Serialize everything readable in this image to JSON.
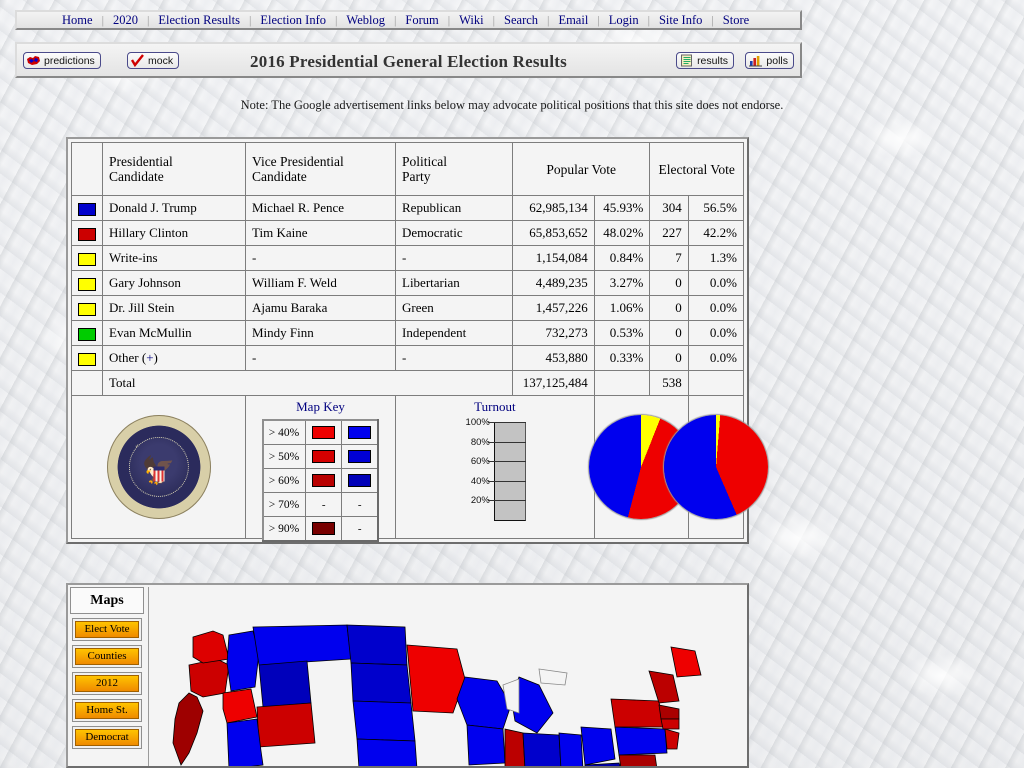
{
  "nav": {
    "items": [
      "Home",
      "2020",
      "Election Results",
      "Election Info",
      "Weblog",
      "Forum",
      "Wiki",
      "Search",
      "Email",
      "Login",
      "Site Info",
      "Store"
    ]
  },
  "header": {
    "title": "2016 Presidential General Election Results",
    "left_buttons": [
      {
        "label": "predictions",
        "icon": "us-map-icon"
      },
      {
        "label": "mock",
        "icon": "checkmark-icon"
      }
    ],
    "right_buttons": [
      {
        "label": "results",
        "icon": "document-icon"
      },
      {
        "label": "polls",
        "icon": "bar-chart-icon"
      }
    ]
  },
  "note": "Note: The Google advertisement links below may advocate political positions that this site does not endorse.",
  "table": {
    "columns": [
      "",
      "Presidential Candidate",
      "Vice Presidential Candidate",
      "Political Party",
      "Popular Vote",
      "Electoral Vote"
    ],
    "headers": {
      "pres": "Presidential\nCandidate",
      "pres_l1": "Presidential",
      "pres_l2": "Candidate",
      "vp_l1": "Vice Presidential",
      "vp_l2": "Candidate",
      "party_l1": "Political",
      "party_l2": "Party",
      "popular": "Popular Vote",
      "electoral": "Electoral Vote"
    },
    "rows": [
      {
        "color": "#0000cc",
        "candidate": "Donald J. Trump",
        "vp": "Michael R. Pence",
        "party": "Republican",
        "popular": "62,985,134",
        "popular_pct": "45.93%",
        "electoral": "304",
        "electoral_pct": "56.5%"
      },
      {
        "color": "#cc0000",
        "candidate": "Hillary Clinton",
        "vp": "Tim Kaine",
        "party": "Democratic",
        "popular": "65,853,652",
        "popular_pct": "48.02%",
        "electoral": "227",
        "electoral_pct": "42.2%"
      },
      {
        "color": "#ffff00",
        "candidate": "Write-ins",
        "vp": "-",
        "party": "-",
        "popular": "1,154,084",
        "popular_pct": "0.84%",
        "electoral": "7",
        "electoral_pct": "1.3%"
      },
      {
        "color": "#ffff00",
        "candidate": "Gary Johnson",
        "vp": "William F. Weld",
        "party": "Libertarian",
        "popular": "4,489,235",
        "popular_pct": "3.27%",
        "electoral": "0",
        "electoral_pct": "0.0%"
      },
      {
        "color": "#ffff00",
        "candidate": "Dr. Jill Stein",
        "vp": "Ajamu Baraka",
        "party": "Green",
        "popular": "1,457,226",
        "popular_pct": "1.06%",
        "electoral": "0",
        "electoral_pct": "0.0%"
      },
      {
        "color": "#00cc00",
        "candidate": "Evan McMullin",
        "vp": "Mindy Finn",
        "party": "Independent",
        "popular": "732,273",
        "popular_pct": "0.53%",
        "electoral": "0",
        "electoral_pct": "0.0%"
      },
      {
        "color": "#ffff00",
        "candidate": "Other (+)",
        "candidate_base": "Other (",
        "candidate_plus": "+",
        "candidate_close": ")",
        "vp": "-",
        "party": "-",
        "popular": "453,880",
        "popular_pct": "0.33%",
        "electoral": "0",
        "electoral_pct": "0.0%"
      }
    ],
    "total": {
      "label": "Total",
      "popular": "137,125,484",
      "popular_pct": "",
      "electoral": "538",
      "electoral_pct": ""
    }
  },
  "seal": {
    "alt": "Seal of the President of the United States"
  },
  "map_key": {
    "title": "Map Key",
    "rows": [
      {
        "label": "> 40%",
        "dem": "#ee0000",
        "rep": "#0000ee",
        "dem_dash": false,
        "rep_dash": false
      },
      {
        "label": "> 50%",
        "dem": "#d40000",
        "rep": "#0000d4",
        "dem_dash": false,
        "rep_dash": false
      },
      {
        "label": "> 60%",
        "dem": "#b80000",
        "rep": "#0000b8",
        "dem_dash": false,
        "rep_dash": false
      },
      {
        "label": "> 70%",
        "dem": "-",
        "rep": "-",
        "dem_dash": true,
        "rep_dash": true
      },
      {
        "label": "> 90%",
        "dem": "#780000",
        "rep": "-",
        "dem_dash": false,
        "rep_dash": true
      }
    ]
  },
  "turnout": {
    "title": "Turnout",
    "ticks": [
      "100%",
      "80%",
      "60%",
      "40%",
      "20%"
    ]
  },
  "maps": {
    "title": "Maps",
    "buttons": [
      "Elect Vote",
      "Counties",
      "2012",
      "Home St.",
      "Democrat"
    ]
  },
  "chart_data": [
    {
      "type": "pie",
      "title": "Popular Vote",
      "labels": [
        "Republican",
        "Democratic",
        "Other"
      ],
      "values": [
        45.93,
        48.02,
        6.03
      ],
      "colors": [
        "#0000ee",
        "#ee0000",
        "#ffff00"
      ],
      "legend": "none"
    },
    {
      "type": "pie",
      "title": "Electoral Vote",
      "labels": [
        "Republican",
        "Democratic",
        "Other"
      ],
      "values": [
        56.5,
        42.2,
        1.3
      ],
      "colors": [
        "#0000ee",
        "#ee0000",
        "#ffff00"
      ],
      "legend": "none"
    },
    {
      "type": "bar",
      "title": "Turnout",
      "categories": [
        "Turnout"
      ],
      "values": [
        0
      ],
      "ylabel": "",
      "ylim": [
        0,
        100
      ],
      "yticks": [
        20,
        40,
        60,
        80,
        100
      ],
      "grid": true
    }
  ]
}
